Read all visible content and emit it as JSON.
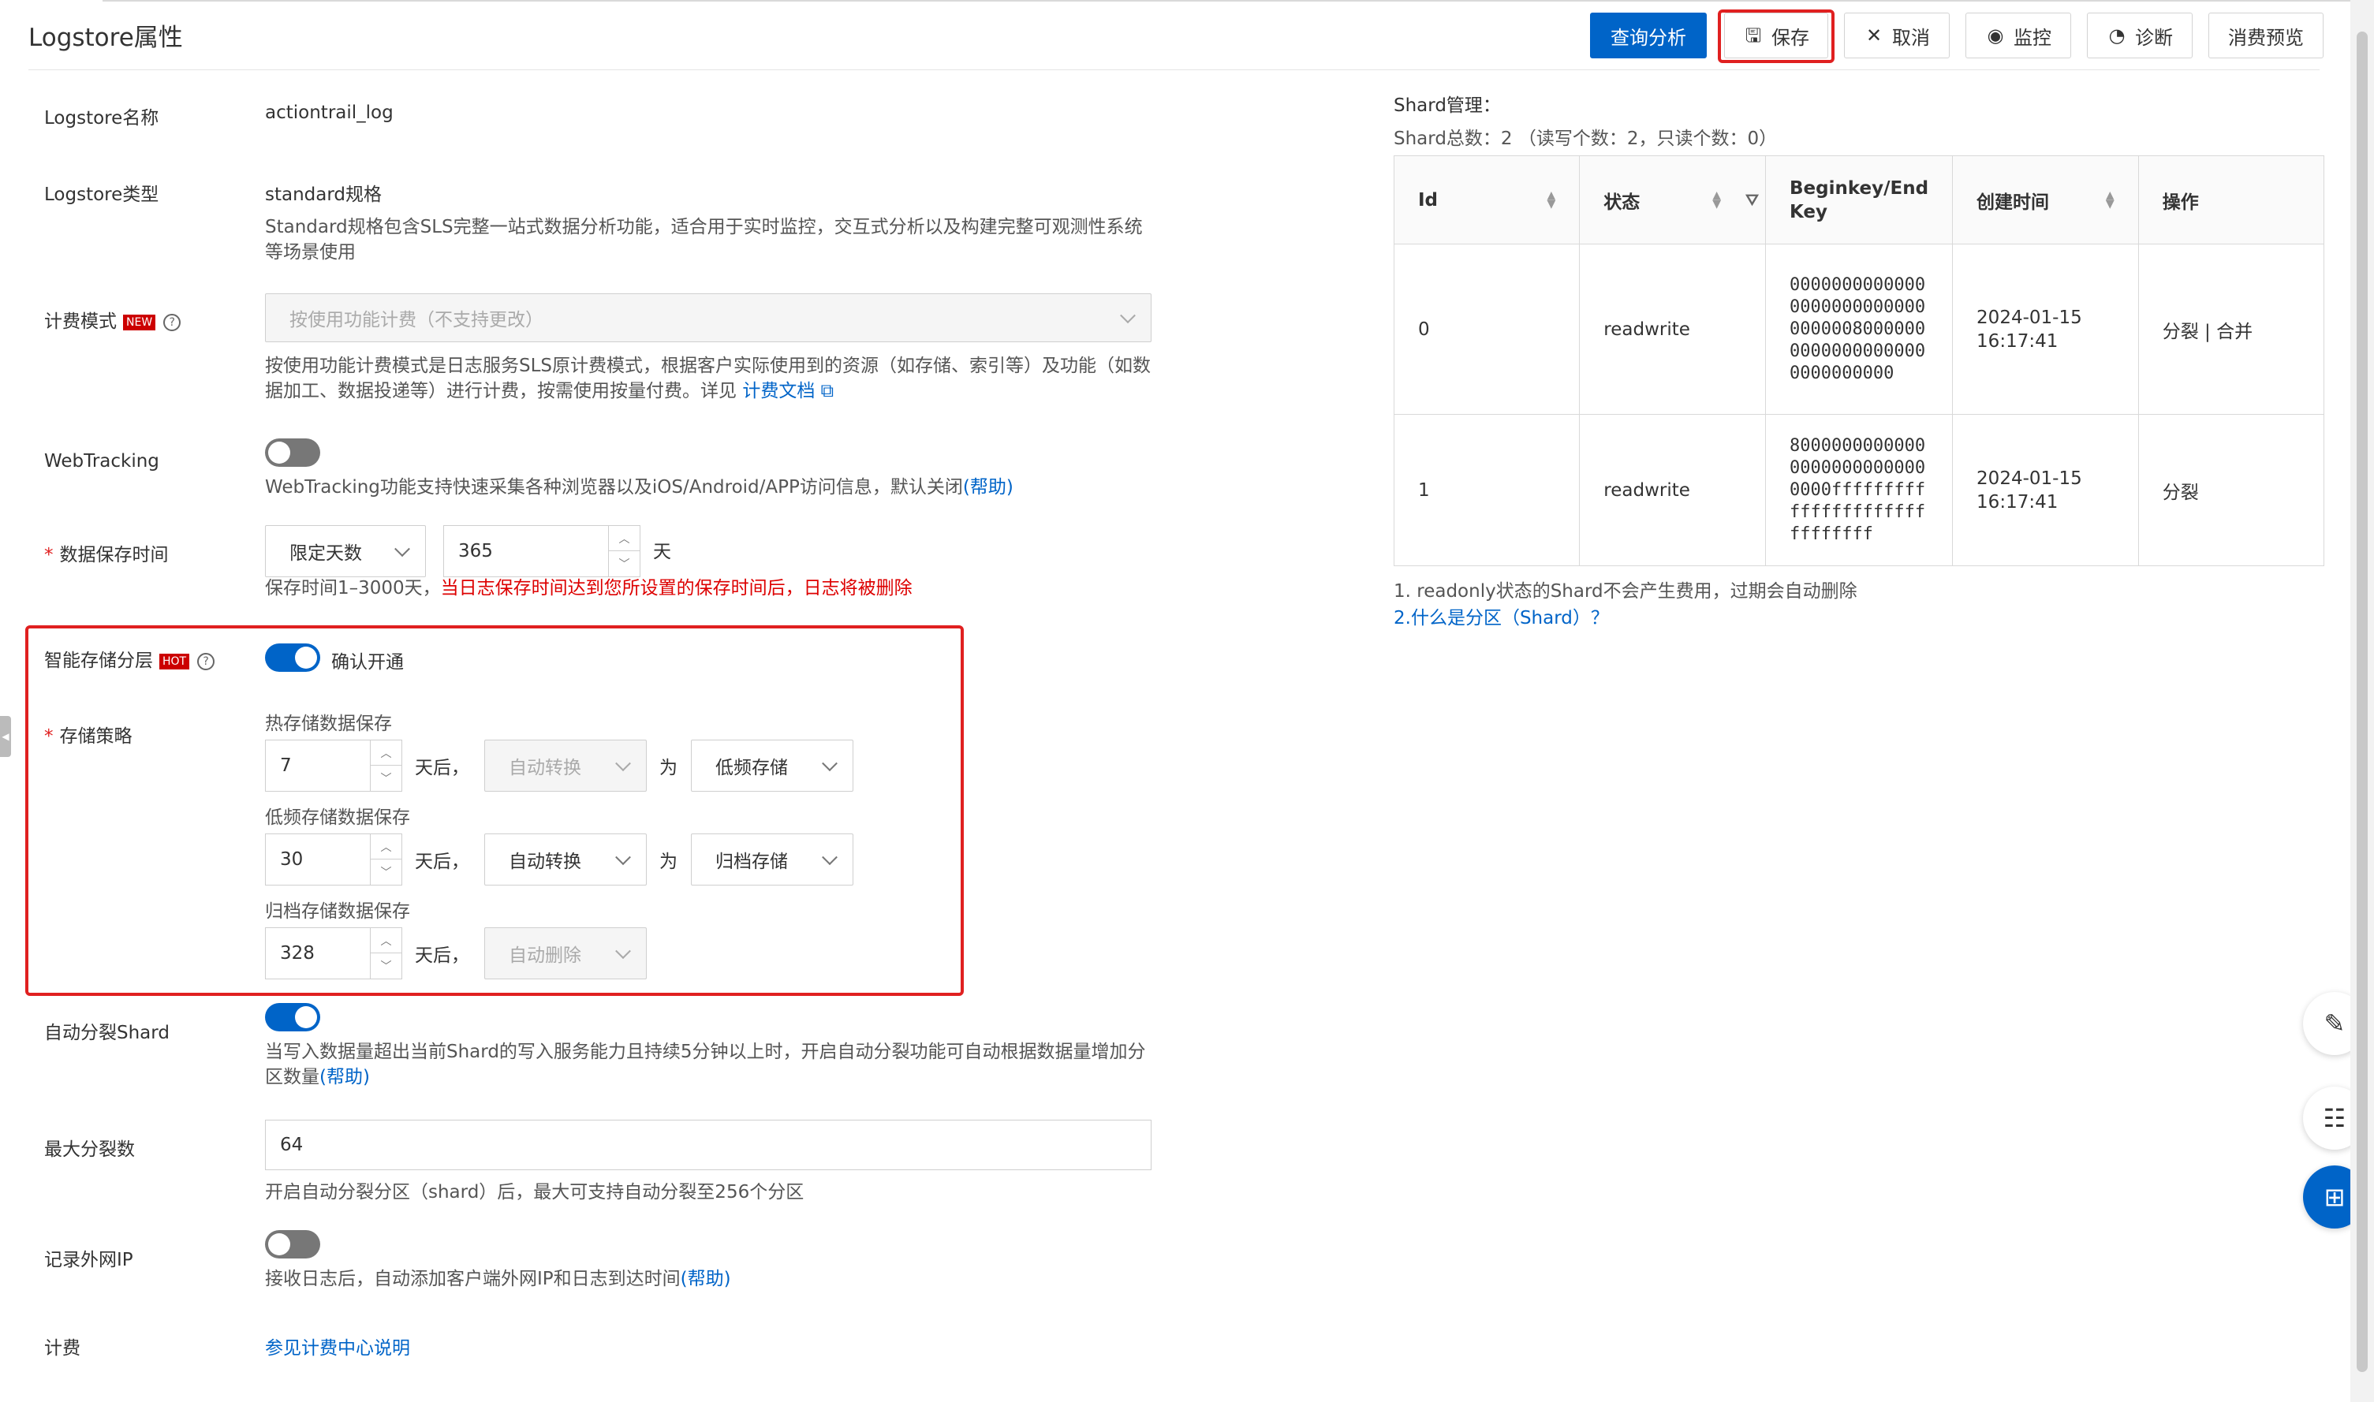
{
  "header": {
    "title": "Logstore属性",
    "buttons": {
      "query": "查询分析",
      "save": "保存",
      "cancel": "取消",
      "monitor": "监控",
      "diagnose": "诊断",
      "cost_preview": "消费预览"
    }
  },
  "form": {
    "logstore_name": {
      "label": "Logstore名称",
      "value": "actiontrail_log"
    },
    "logstore_type": {
      "label": "Logstore类型",
      "value": "standard规格",
      "desc": "Standard规格包含SLS完整一站式数据分析功能，适合用于实时监控，交互式分析以及构建完整可观测性系统等场景使用"
    },
    "billing_mode": {
      "label": "计费模式",
      "badge": "NEW",
      "select_value": "按使用功能计费（不支持更改）",
      "desc": "按使用功能计费模式是日志服务SLS原计费模式，根据客户实际使用到的资源（如存储、索引等）及功能（如数据加工、数据投递等）进行计费，按需使用按量付费。详见",
      "link": "计费文档"
    },
    "webtracking": {
      "label": "WebTracking",
      "enabled": false,
      "desc": "WebTracking功能支持快速采集各种浏览器以及iOS/Android/APP访问信息，默认关闭",
      "help": "(帮助)"
    },
    "retention": {
      "label": "数据保存时间",
      "mode": "限定天数",
      "days": "365",
      "unit": "天",
      "desc": "保存时间1–3000天，",
      "warn": "当日志保存时间达到您所设置的保存时间后，日志将被删除"
    },
    "tiered_storage": {
      "label": "智能存储分层",
      "badge": "HOT",
      "enabled": true,
      "toggle_text": "确认开通",
      "policy_label": "存储策略",
      "after": "天后，",
      "as": "为",
      "hot": {
        "title": "热存储数据保存",
        "days": "7",
        "action": "自动转换",
        "target": "低频存储"
      },
      "ia": {
        "title": "低频存储数据保存",
        "days": "30",
        "action": "自动转换",
        "target": "归档存储"
      },
      "archive": {
        "title": "归档存储数据保存",
        "days": "328",
        "action": "自动删除"
      }
    },
    "auto_split": {
      "label": "自动分裂Shard",
      "enabled": true,
      "desc": "当写入数据量超出当前Shard的写入服务能力且持续5分钟以上时，开启自动分裂功能可自动根据数据量增加分区数量",
      "help": "(帮助)"
    },
    "max_split": {
      "label": "最大分裂数",
      "value": "64",
      "desc": "开启自动分裂分区（shard）后，最大可支持自动分裂至256个分区"
    },
    "record_ip": {
      "label": "记录外网IP",
      "enabled": false,
      "desc": "接收日志后，自动添加客户端外网IP和日志到达时间",
      "help": "(帮助)"
    },
    "billing": {
      "label": "计费",
      "link": "参见计费中心说明"
    }
  },
  "shard": {
    "title": "Shard管理：",
    "summary": "Shard总数：2 （读写个数：2，只读个数：0）",
    "columns": [
      "Id",
      "状态",
      "Beginkey/End Key",
      "创建时间",
      "操作"
    ],
    "rows": [
      {
        "id": "0",
        "status": "readwrite",
        "key": "00000000000000000000000000000000800000000000000000000000000000",
        "created": "2024-01-15 16:17:41",
        "ops": "分裂 | 合并"
      },
      {
        "id": "1",
        "status": "readwrite",
        "key": "800000000000000000000000000000ffffffffffffffffffffffffffffff",
        "created": "2024-01-15 16:17:41",
        "ops": "分裂"
      }
    ],
    "note1": "1. readonly状态的Shard不会产生费用，过期会自动删除",
    "note2": "2.什么是分区（Shard）？"
  },
  "icons": [
    "save-icon",
    "close-icon",
    "monitor-icon",
    "diagnose-icon",
    "edit-icon",
    "chat-icon",
    "apps-icon",
    "external-link-icon",
    "filter-icon",
    "sort-icon",
    "chevron-down-icon",
    "help-icon"
  ]
}
